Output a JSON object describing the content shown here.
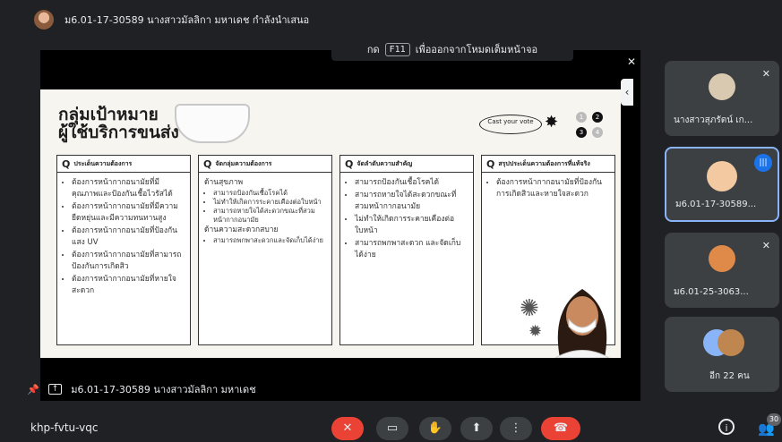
{
  "presenter_banner": "ม6.01-17-30589 นางสาวมัลลิกา มหาเดช กำลังนำเสนอ",
  "fullscreen_hint": {
    "prefix": "กด",
    "key": "F11",
    "suffix": "เพื่อออกจากโหมดเต็มหน้าจอ"
  },
  "slide": {
    "title_line1": "กลุ่มเป้าหมาย",
    "title_line2": "ผู้ใช้บริการขนส่ง",
    "cast_vote": "Cast your vote",
    "dots": [
      "1",
      "2",
      "3",
      "4"
    ],
    "columns": [
      {
        "header": "ประเด็นความต้องการ",
        "items": [
          "ต้องการหน้ากากอนามัยที่มีคุณภาพและป้องกันเชื้อไวรัสได้",
          "ต้องการหน้ากากอนามัยที่มีความยืดหยุ่นและมีความทนทานสูง",
          "ต้องการหน้ากากอนามัยที่ป้องกันแสง UV",
          "ต้องการหน้ากากอนามัยที่สามารถป้องกันการเกิดสิว",
          "ต้องการหน้ากากอนามัยที่หายใจสะดวก"
        ]
      },
      {
        "header": "จัดกลุ่มความต้องการ",
        "group1": "ด้านสุขภาพ",
        "group1_items": [
          "สามารถป้องกันเชื้อโรคได้",
          "ไม่ทำให้เกิดการระคายเคืองต่อใบหน้า",
          "สามารถหายใจได้สะดวกขณะที่สวมหน้ากากอนามัย"
        ],
        "group2": "ด้านความสะดวกสบาย",
        "group2_items": [
          "สามารถพกพาสะดวกและจัดเก็บได้ง่าย"
        ]
      },
      {
        "header": "จัดลำดับความสำคัญ",
        "items": [
          "สามารถป้องกันเชื้อโรคได้",
          "สามารถหายใจได้สะดวกขณะที่สวมหน้ากากอนามัย",
          "ไม่ทำให้เกิดการระคายเคืองต่อใบหน้า",
          "สามารถพกพาสะดวก และจัดเก็บได้ง่าย"
        ]
      },
      {
        "header": "สรุปประเด็นความต้องการที่แท้จริง",
        "items": [
          "ต้องการหน้ากากอนามัยที่ป้องกันการเกิดสิวและหายใจสะดวก"
        ]
      }
    ]
  },
  "pin_bar": {
    "label": "ม6.01-17-30589 นางสาวมัลลิกา มหาเดช"
  },
  "participants": [
    {
      "name": "นางสาวสุภรัตน์ เก...",
      "muted": true,
      "speaking": false
    },
    {
      "name": "ม6.01-17-30589...",
      "muted": false,
      "speaking": true
    },
    {
      "name": "ม6.01-25-3063...",
      "muted": true,
      "speaking": false
    },
    {
      "name": "อีก 22 คน",
      "muted": false,
      "speaking": false
    }
  ],
  "meeting_code": "khp-fvtu-vqc",
  "participant_count": "30",
  "colors": {
    "bg": "#202124",
    "tile": "#3c4043",
    "end_call": "#ea4335",
    "speaking": "#1a73e8"
  }
}
